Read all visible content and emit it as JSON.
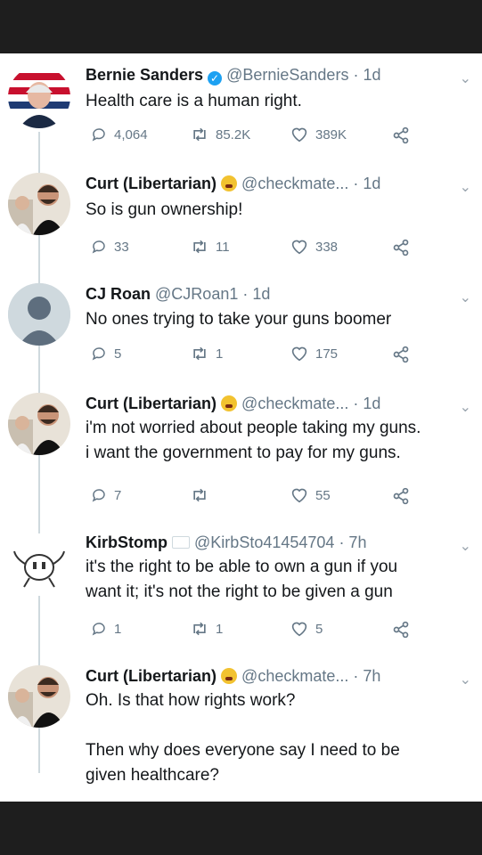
{
  "tweets": [
    {
      "name": "Bernie Sanders",
      "handle": "@BernieSanders",
      "time": "· 1d",
      "text": "Health care is a human right.",
      "replies": "4,064",
      "retweets": "85.2K",
      "likes": "389K",
      "verified": true,
      "avatar": "bernie-avatar"
    },
    {
      "name": "Curt (Libertarian)",
      "handle": "@checkmate...",
      "time": "· 1d",
      "text": "So is gun ownership!",
      "replies": "33",
      "retweets": "11",
      "likes": "338",
      "emoji": "mind-blown-emoji",
      "avatar": "curt-avatar"
    },
    {
      "name": "CJ Roan",
      "handle": "@CJRoan1",
      "time": "· 1d",
      "text": "No ones trying to take your guns boomer",
      "replies": "5",
      "retweets": "1",
      "likes": "175",
      "avatar": "default-avatar"
    },
    {
      "name": "Curt (Libertarian)",
      "handle": "@checkmate...",
      "time": "· 1d",
      "text": "i'm not worried about people taking my guns.\ni want the government to pay for my guns.",
      "replies": "7",
      "retweets": "",
      "likes": "55",
      "emoji": "mind-blown-emoji",
      "avatar": "curt-avatar"
    },
    {
      "name": "KirbStomp",
      "handle": "@KirbSto41454704",
      "time": "· 7h",
      "text": "it's the right to be able to own a gun if you\nwant it; it's not the right to be given a gun",
      "replies": "1",
      "retweets": "1",
      "likes": "5",
      "avatar": "kirb-avatar"
    },
    {
      "name": "Curt (Libertarian)",
      "handle": "@checkmate...",
      "time": "· 7h",
      "text": "Oh. Is that how rights work?\n\nThen why does everyone say I need to be\ngiven healthcare?",
      "emoji": "mind-blown-emoji",
      "avatar": "curt-avatar"
    }
  ],
  "colors": {
    "text": "#14171a",
    "muted": "#657786",
    "line": "#cfd9de",
    "verified": "#1da1f2"
  }
}
